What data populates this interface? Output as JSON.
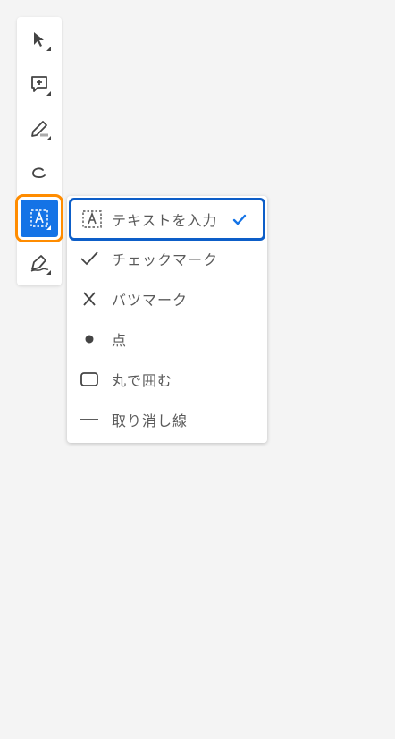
{
  "toolbar": {
    "tools": [
      {
        "name": "select-tool",
        "icon": "arrow-cursor-icon"
      },
      {
        "name": "add-comment-tool",
        "icon": "comment-add-icon"
      },
      {
        "name": "highlight-tool",
        "icon": "highlighter-icon"
      },
      {
        "name": "draw-tool",
        "icon": "freehand-draw-icon"
      },
      {
        "name": "text-tool",
        "icon": "text-box-icon",
        "active": true
      },
      {
        "name": "sign-tool",
        "icon": "pen-sign-icon"
      }
    ]
  },
  "menu": {
    "items": [
      {
        "label": "テキストを入力",
        "icon": "text-box-icon",
        "selected": true
      },
      {
        "label": "チェックマーク",
        "icon": "checkmark-icon"
      },
      {
        "label": "バツマーク",
        "icon": "x-mark-icon"
      },
      {
        "label": "点",
        "icon": "dot-icon"
      },
      {
        "label": "丸で囲む",
        "icon": "rounded-rect-icon"
      },
      {
        "label": "取り消し線",
        "icon": "strikethrough-line-icon"
      }
    ]
  },
  "colors": {
    "accent": "#1473e6",
    "focus_ring": "#ff8c00",
    "selected_border": "#0d5ec8",
    "background": "#f4f4f4"
  }
}
